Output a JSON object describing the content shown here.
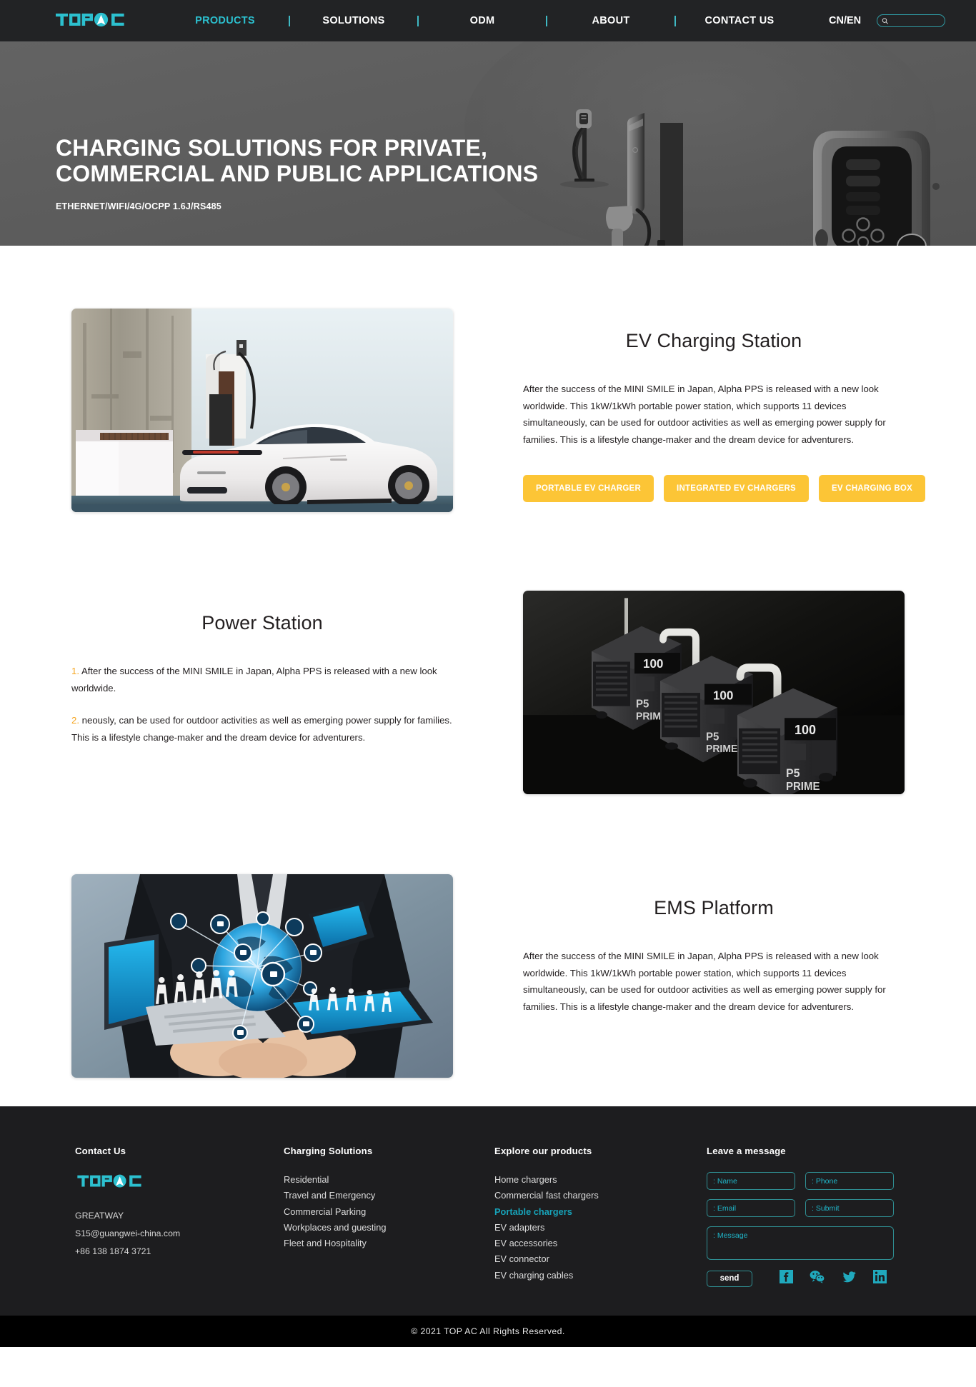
{
  "brand": {
    "logo_text_left": "TOP",
    "logo_text_right": "C",
    "logo_badge": "A",
    "accent": "#2cc0cf",
    "accent_dark": "#17a2b8",
    "yellow": "#fcc536",
    "header_bg": "#222325",
    "hero_bg": "#5c5c5c",
    "footer_bg": "#1d1d1f"
  },
  "header": {
    "nav": [
      {
        "label": "PRODUCTS",
        "active": true
      },
      {
        "label": "SOLUTIONS",
        "active": false
      },
      {
        "label": "ODM",
        "active": false
      },
      {
        "label": "ABOUT",
        "active": false
      },
      {
        "label": "CONTACT US",
        "active": false
      }
    ],
    "language_switch": "CN/EN",
    "search_placeholder": "",
    "search_value": "",
    "search_icon": "search-icon"
  },
  "hero": {
    "title": "CHARGING SOLUTIONS FOR PRIVATE, COMMERCIAL AND PUBLIC APPLICATIONS",
    "subtitle": "ETHERNET/WIFI/4G/OCPP 1.6J/RS485"
  },
  "sections": [
    {
      "id": "ev-charging-station",
      "title": "EV Charging Station",
      "image_alt": "White electric sports car charging at an EV charging station beside a concrete wall",
      "body": "After the success of the MINI SMILE in Japan, Alpha PPS is released with a new look worldwide. This 1kW/1kWh portable power station, which supports 11 devices simultaneously, can be used for outdoor activities as well as emerging power supply for families. This is a lifestyle change-maker and the dream device for adventurers.",
      "buttons": [
        "PORTABLE EV CHARGER",
        "INTEGRATED EV CHARGERS",
        "EV CHARGING BOX"
      ]
    },
    {
      "id": "power-station",
      "title": "Power Station",
      "image_alt": "Three P5 PRIME portable power stations on a dark reflective surface",
      "paragraphs": [
        {
          "num": "1.",
          "text": "After the success of the MINI SMILE in Japan, Alpha PPS is released with a new look worldwide."
        },
        {
          "num": "2.",
          "text": "neously, can be used for outdoor activities as well as emerging power supply for families. This is a lifestyle change-maker and the dream device for adventurers."
        }
      ]
    },
    {
      "id": "ems-platform",
      "title": "EMS Platform",
      "image_alt": "Businessman holding devices connected by a glowing global network",
      "body": "After the success of the MINI SMILE in Japan, Alpha PPS is released with a new look worldwide. This 1kW/1kWh portable power station, which supports 11 devices simultaneously, can be used for outdoor activities as well as emerging power supply for families. This is a lifestyle change-maker and the dream device for adventurers."
    }
  ],
  "footer": {
    "contact": {
      "heading": "Contact Us",
      "company": "GREATWAY",
      "email": "S15@guangwei-china.com",
      "phone": "+86 138 1874 3721"
    },
    "solutions": {
      "heading": "Charging Solutions",
      "items": [
        "Residential",
        "Travel and Emergency",
        "Commercial Parking",
        "Workplaces and guesting",
        "Fleet and Hospitality"
      ]
    },
    "products": {
      "heading": "Explore our products",
      "items": [
        {
          "label": "Home chargers",
          "highlight": false
        },
        {
          "label": "Commercial fast chargers",
          "highlight": false
        },
        {
          "label": "Portable chargers",
          "highlight": true
        },
        {
          "label": "EV adapters",
          "highlight": false
        },
        {
          "label": "EV accessories",
          "highlight": false
        },
        {
          "label": "EV connector",
          "highlight": false
        },
        {
          "label": "EV charging cables",
          "highlight": false
        }
      ]
    },
    "message": {
      "heading": "Leave a message",
      "name_placeholder": ": Name",
      "phone_placeholder": ": Phone",
      "email_placeholder": ": Email",
      "submit_placeholder": ": Submit",
      "message_placeholder": ": Message",
      "send_label": "send",
      "name_value": "",
      "phone_value": "",
      "email_value": "",
      "submit_value": "",
      "message_value": "",
      "socials": [
        {
          "name": "facebook-icon"
        },
        {
          "name": "wechat-icon"
        },
        {
          "name": "twitter-icon"
        },
        {
          "name": "linkedin-icon"
        }
      ]
    },
    "copyright": "©  2021   TOP AC  All Rights Reserved."
  }
}
